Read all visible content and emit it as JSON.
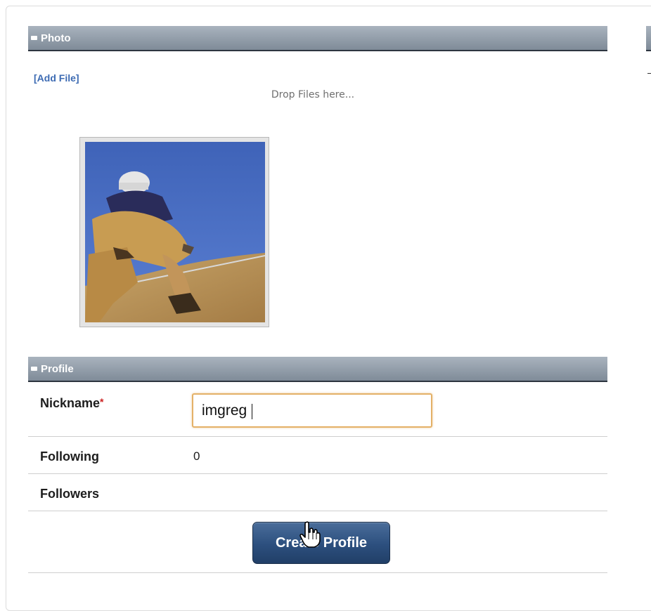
{
  "photo_section": {
    "title": "Photo",
    "add_file_label": "[Add File]",
    "drop_hint": "Drop Files here..."
  },
  "profile_section": {
    "title": "Profile",
    "nickname_label": "Nickname",
    "required_marker": "*",
    "nickname_value": "imgreg",
    "following_label": "Following",
    "following_value": "0",
    "followers_label": "Followers",
    "followers_value": ""
  },
  "actions": {
    "create_profile_label": "Create Profile"
  },
  "colors": {
    "header_gradient_top": "#a9b3be",
    "header_gradient_bottom": "#7f8b98",
    "link": "#3d6bb3",
    "button": "#2c4f7e",
    "input_focus_border": "#e4b167",
    "required": "#cc2222"
  },
  "icons": {
    "section_toggle": "collapse-icon",
    "pointer": "hand-cursor-icon"
  }
}
